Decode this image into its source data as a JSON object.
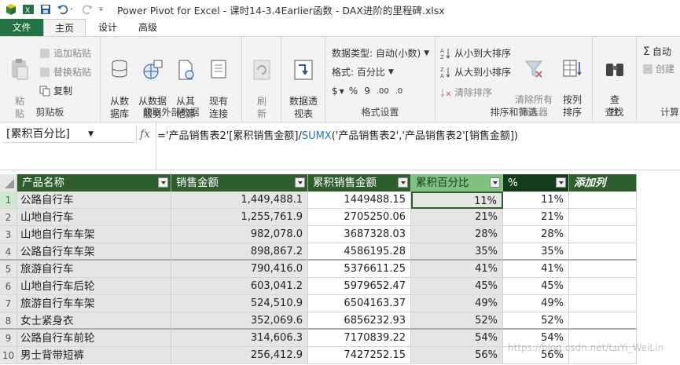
{
  "window": {
    "title": "Power Pivot for Excel - 课时14-3.4Earlier函数 - DAX进阶的里程碑.xlsx"
  },
  "tabs": [
    {
      "label": "文件"
    },
    {
      "label": "主页"
    },
    {
      "label": "设计"
    },
    {
      "label": "高级"
    }
  ],
  "ribbon": {
    "clipboard": {
      "paste": "粘\n贴",
      "append_paste": "追加粘贴",
      "replace_paste": "替换粘贴",
      "copy": "复制",
      "label": "剪贴板"
    },
    "external": {
      "from_db": "从数\n据库",
      "from_service": "从数据\n服务",
      "from_other": "从其\n他源",
      "existing": "现有\n连接",
      "label": "获取外部数据"
    },
    "refresh": {
      "label": "刷\n新"
    },
    "pivot": {
      "label": "数据透\n视表"
    },
    "format": {
      "datatype": "数据类型: 自动(小数)",
      "format": "格式: 百分比",
      "currency": "$",
      "percent": "%",
      "comma": "9",
      "dec_up": ".00",
      "dec_down": ".0",
      "label": "格式设置"
    },
    "sort": {
      "asc": "从小到大排序",
      "desc": "从大到小排序",
      "clear": "清除排序",
      "clear_filters": "清除所有\n筛选器",
      "by_col": "按列\n排序",
      "label": "排序和筛选"
    },
    "find": {
      "btn": "查\n找",
      "label": "查找"
    },
    "calc": {
      "autosum": "自动",
      "create": "创建",
      "label": "计算"
    }
  },
  "formula_bar": {
    "name_box": "[累积百分比]",
    "fx": "fx",
    "formula_part1": "='产品销售表2'[累积销售金额]/",
    "formula_kw": "SUMX",
    "formula_part2": "('产品销售表2','产品销售表2'[销售金额])"
  },
  "table": {
    "headers": [
      "产品名称",
      "销售金额",
      "累积销售金额",
      "累积百分比",
      "%",
      "添加列"
    ],
    "rows": [
      {
        "n": "1",
        "name": "公路自行车",
        "amount": "1,449,488.1",
        "cum": "1449488.15",
        "pct": "11%",
        "p2": "11%"
      },
      {
        "n": "2",
        "name": "山地自行车",
        "amount": "1,255,761.9",
        "cum": "2705250.06",
        "pct": "21%",
        "p2": "21%"
      },
      {
        "n": "3",
        "name": "山地自行车车架",
        "amount": "982,078.0",
        "cum": "3687328.03",
        "pct": "28%",
        "p2": "28%"
      },
      {
        "n": "4",
        "name": "公路自行车车架",
        "amount": "898,867.2",
        "cum": "4586195.28",
        "pct": "35%",
        "p2": "35%"
      },
      {
        "n": "5",
        "name": "旅游自行车",
        "amount": "790,416.0",
        "cum": "5376611.25",
        "pct": "41%",
        "p2": "41%"
      },
      {
        "n": "6",
        "name": "山地自行车后轮",
        "amount": "603,041.2",
        "cum": "5979652.47",
        "pct": "45%",
        "p2": "45%"
      },
      {
        "n": "7",
        "name": "旅游自行车车架",
        "amount": "524,510.9",
        "cum": "6504163.37",
        "pct": "49%",
        "p2": "49%"
      },
      {
        "n": "8",
        "name": "女士紧身衣",
        "amount": "352,069.6",
        "cum": "6856232.93",
        "pct": "52%",
        "p2": "52%"
      },
      {
        "n": "9",
        "name": "公路自行车前轮",
        "amount": "314,606.3",
        "cum": "7170839.22",
        "pct": "54%",
        "p2": "54%"
      },
      {
        "n": "10",
        "name": "男士背带短裤",
        "amount": "256,412.9",
        "cum": "7427252.15",
        "pct": "56%",
        "p2": "56%"
      }
    ]
  },
  "watermark": "https://blog.csdn.net/LuYi_WeiLin",
  "colors": {
    "header_green": "#2e5d2e",
    "file_tab": "#217346"
  }
}
